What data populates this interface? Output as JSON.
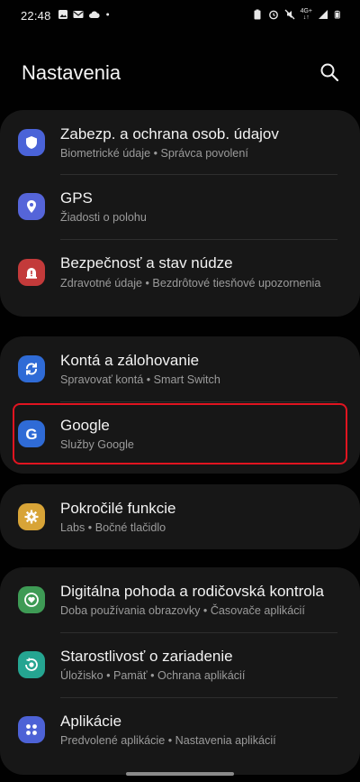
{
  "status": {
    "time": "22:48",
    "network_top": "4G+",
    "network_bottom": "↓↑"
  },
  "header": {
    "title": "Nastavenia"
  },
  "colors": {
    "highlight": "#e01420",
    "security": "#4a63d8",
    "gps": "#5565d9",
    "emergency": "#c33a3a",
    "accounts": "#2f6bd6",
    "google": "#2f6bd6",
    "advanced": "#d8a437",
    "wellbeing": "#3e9b55",
    "care": "#25a591",
    "apps": "#4d62d6"
  },
  "groups": [
    {
      "items": [
        {
          "title": "Zabezp. a ochrana osob. údajov",
          "subtitle": "Biometrické údaje • Správca povolení",
          "icon": "shield-icon"
        },
        {
          "title": "GPS",
          "subtitle": "Žiadosti o polohu",
          "icon": "location-pin-icon"
        },
        {
          "title": "Bezpečnosť a stav núdze",
          "subtitle": "Zdravotné údaje • Bezdrôtové tiesňové upozornenia",
          "icon": "emergency-alert-icon"
        }
      ]
    },
    {
      "items": [
        {
          "title": "Kontá a zálohovanie",
          "subtitle": "Spravovať kontá • Smart Switch",
          "icon": "sync-icon"
        },
        {
          "title": "Google",
          "subtitle": "Služby Google",
          "icon": "google-icon"
        }
      ]
    },
    {
      "items": [
        {
          "title": "Pokročilé funkcie",
          "subtitle": "Labs • Bočné tlačidlo",
          "icon": "gear-plus-icon"
        }
      ]
    },
    {
      "items": [
        {
          "title": "Digitálna pohoda a rodičovská kontrola",
          "subtitle": "Doba používania obrazovky • Časovače aplikácií",
          "icon": "heart-circle-icon"
        },
        {
          "title": "Starostlivosť o zariadenie",
          "subtitle": "Úložisko • Pamäť • Ochrana aplikácií",
          "icon": "device-care-icon"
        },
        {
          "title": "Aplikácie",
          "subtitle": "Predvolené aplikácie • Nastavenia aplikácií",
          "icon": "apps-grid-icon"
        }
      ]
    }
  ]
}
